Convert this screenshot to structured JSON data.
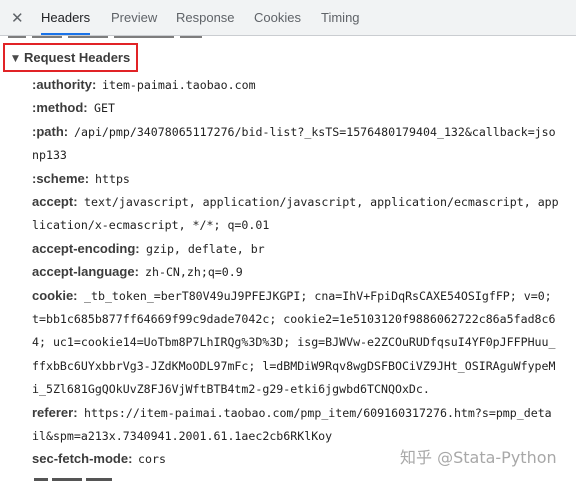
{
  "tabs": {
    "close_label": "✕",
    "items": [
      {
        "label": "Headers",
        "active": true
      },
      {
        "label": "Preview"
      },
      {
        "label": "Response"
      },
      {
        "label": "Cookies"
      },
      {
        "label": "Timing"
      }
    ]
  },
  "section": {
    "title": "Request Headers",
    "toggle_icon": "▼"
  },
  "headers": [
    {
      "name": ":authority:",
      "lines": [
        "item-paimai.taobao.com"
      ]
    },
    {
      "name": ":method:",
      "lines": [
        "GET"
      ]
    },
    {
      "name": ":path:",
      "lines": [
        "/api/pmp/34078065117276/bid-list?_ksTS=1576480179404_132&callback=jso",
        "np133"
      ]
    },
    {
      "name": ":scheme:",
      "lines": [
        "https"
      ]
    },
    {
      "name": "accept:",
      "lines": [
        "text/javascript, application/javascript, application/ecmascript, app",
        "lication/x-ecmascript, */*; q=0.01"
      ]
    },
    {
      "name": "accept-encoding:",
      "lines": [
        "gzip, deflate, br"
      ]
    },
    {
      "name": "accept-language:",
      "lines": [
        "zh-CN,zh;q=0.9"
      ]
    },
    {
      "name": "cookie:",
      "lines": [
        "_tb_token_=berT80V49uJ9PFEJKGPI; cna=IhV+FpiDqRsCAXE54OSIgfFP; v=0;",
        "t=bb1c685b877ff64669f99c9dade7042c; cookie2=1e5103120f9886062722c86a5fad8c6",
        "4; uc1=cookie14=UoTbm8P7LhIRQg%3D%3D; isg=BJWVw-e2ZCOuRUDfqsuI4YF0pJFFPHuu_",
        "ffxbBc6UYxbbrVg3-JZdKMoODL97mFc; l=dBMDiW9Rqv8wgDSFBOCiVZ9JHt_OSIRAguWfypeM",
        "i_5Zl681GgQOkUvZ8FJ6VjWftBTB4tm2-g29-etki6jgwbd6TCNQOxDc."
      ]
    },
    {
      "name": "referer:",
      "lines": [
        "https://item-paimai.taobao.com/pmp_item/609160317276.htm?s=pmp_deta",
        "il&spm=a213x.7340941.2001.61.1aec2cb6RKlKoy"
      ]
    },
    {
      "name": "sec-fetch-mode:",
      "lines": [
        "cors"
      ]
    }
  ],
  "watermark": "知乎 @Stata-Python"
}
